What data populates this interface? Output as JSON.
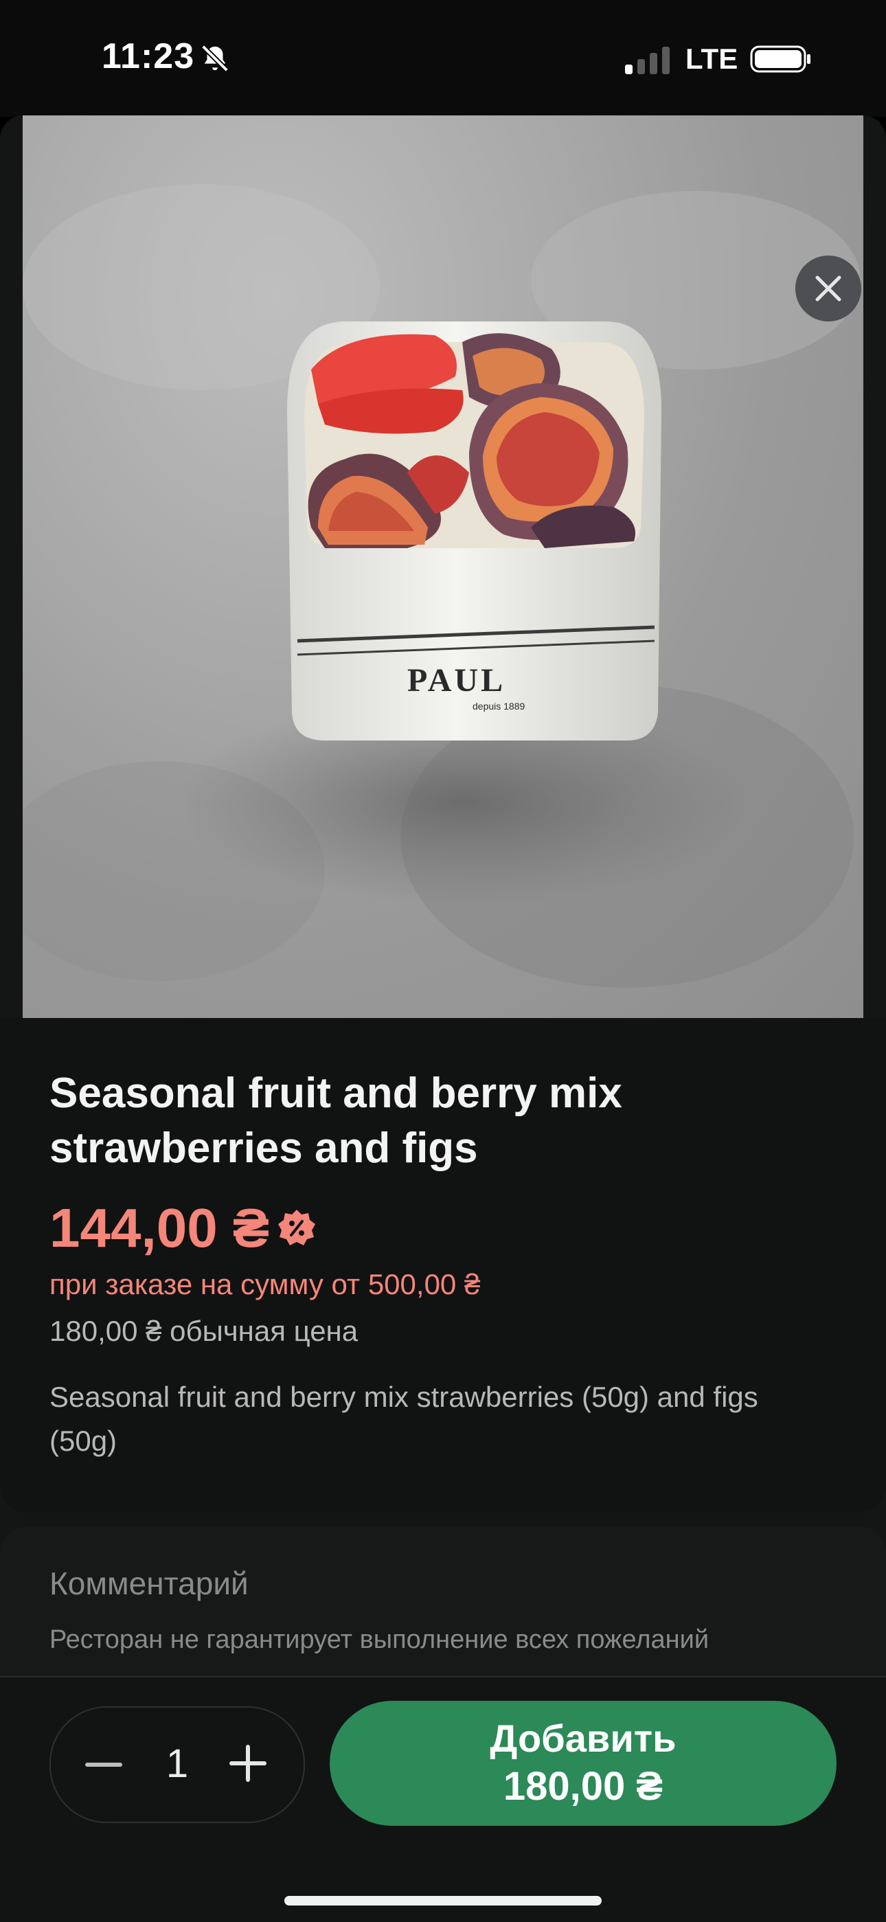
{
  "status_bar": {
    "time": "11:23",
    "network": "LTE",
    "icons": [
      "bell-slash-icon",
      "signal-icon",
      "battery-icon"
    ]
  },
  "product": {
    "image_brand": "PAUL",
    "image_brand_sub": "depuis 1889",
    "title": "Seasonal fruit and berry mix strawberries and figs",
    "price": "144,00 ₴",
    "promo_icon": "discount-badge-icon",
    "promo_condition": "при заказе на сумму от 500,00 ₴",
    "regular_price": "180,00 ₴ обычная цена",
    "description": "Seasonal fruit and berry mix strawberries (50g) and figs (50g)"
  },
  "comment": {
    "title": "Комментарий",
    "hint": "Ресторан не гарантирует выполнение всех пожеланий"
  },
  "cart": {
    "quantity": "1",
    "add_label": "Добавить",
    "add_price": "180,00 ₴"
  },
  "colors": {
    "accent_green": "#2b8a57",
    "promo_red": "#f4867a"
  }
}
